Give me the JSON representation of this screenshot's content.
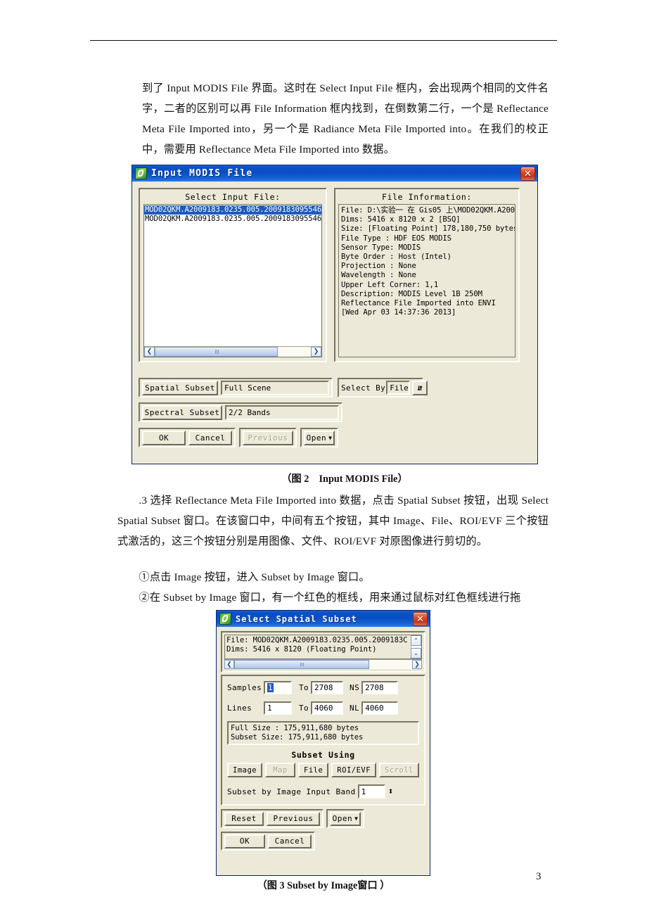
{
  "document": {
    "page_number": "3",
    "paragraph_top": "到了 Input MODIS File 界面。这时在 Select Input File 框内，会出现两个相同的文件名字，二者的区别可以再 File Information 框内找到，在倒数第二行，一个是 Reflectance Meta File Imported into，另一个是 Radiance Meta File Imported into。在我们的校正中，需要用 Reflectance Meta File Imported into 数据。",
    "figure2_caption": "（图 2　Input MODIS File）",
    "paragraph_mid": ".3 选择 Reflectance Meta File Imported into 数据，点击 Spatial Subset 按钮，出现 Select Spatial Subset 窗口。在该窗口中，中间有五个按钮，其中 Image、File、ROI/EVF 三个按钮式激活的，这三个按钮分别是用图像、文件、ROI/EVF 对原图像进行剪切的。",
    "paragraph_item1": "①点击 Image 按钮，进入 Subset by Image 窗口。",
    "paragraph_item2": "②在 Subset by Image 窗口，有一个红色的框线，用来通过鼠标对红色框线进行拖",
    "figure3_caption": "（图 3  Subset by Image窗口 ）"
  },
  "colors": {
    "titlebar_blue": "#0a4ec4",
    "dialog_face": "#ece9d8",
    "selection_blue": "#1f5bbf",
    "close_red": "#c5351a"
  },
  "input_modis_dialog": {
    "title": "Input MODIS File",
    "close_label": "✕",
    "select_input_file": {
      "group_label": "Select Input File:",
      "items": [
        "MOD02QKM.A2009183.0235.005.2009183095546",
        "MOD02QKM.A2009183.0235.005.2009183095546"
      ],
      "selected_index": 0,
      "scroll_left_arrow": "❮",
      "scroll_right_arrow": "❯"
    },
    "file_information": {
      "group_label": "File Information:",
      "lines": [
        "File: D:\\实验一 在 Gis05 上\\MOD02QKM.A200",
        "Dims: 5416 x 8120 x 2 [BSQ]",
        "Size: [Floating Point] 178,180,750 bytes.",
        "File Type  : HDF EOS MODIS",
        "Sensor Type: MODIS",
        "Byte Order : Host (Intel)",
        "Projection : None",
        "Wavelength : None",
        "Upper Left Corner: 1,1",
        "Description: MODIS Level 1B 250M",
        "Reflectance File Imported into ENVI",
        "[Wed Apr 03 14:37:36 2013]"
      ]
    },
    "spatial_subset": {
      "button_label": "Spatial Subset",
      "value": "Full Scene"
    },
    "spectral_subset": {
      "button_label": "Spectral Subset",
      "value": "2/2 Bands"
    },
    "select_by": {
      "label": "Select By",
      "value": "File",
      "toggle_icon": "⇵"
    },
    "buttons": {
      "ok": "OK",
      "cancel": "Cancel",
      "previous": "Previous",
      "previous_disabled": true,
      "open": "Open",
      "open_arrow": "▼"
    }
  },
  "spatial_subset_dialog": {
    "title": "Select Spatial Subset",
    "close_label": "✕",
    "file_info": {
      "lines": [
        "File: MOD02QKM.A2009183.0235.005.2009183C",
        "Dims: 5416 x 8120 (Floating Point)"
      ],
      "up_arrow": "⌃",
      "down_arrow": "⌄",
      "scroll_left_arrow": "❮",
      "scroll_right_arrow": "❯"
    },
    "samples": {
      "label": "Samples",
      "from": "1",
      "to_label": "To",
      "to": "2708",
      "count_label": "NS",
      "count": "2708"
    },
    "lines": {
      "label": "Lines",
      "from": "1",
      "to_label": "To",
      "to": "4060",
      "count_label": "NL",
      "count": "4060"
    },
    "sizes": {
      "full": "Full Size  : 175,911,680 bytes",
      "subset": "Subset Size: 175,911,680 bytes"
    },
    "subset_using": {
      "heading": "Subset Using",
      "buttons": [
        {
          "label": "Image",
          "disabled": false
        },
        {
          "label": "Map",
          "disabled": true
        },
        {
          "label": "File",
          "disabled": false
        },
        {
          "label": "ROI/EVF",
          "disabled": false
        },
        {
          "label": "Scroll",
          "disabled": true
        }
      ]
    },
    "input_band": {
      "label": "Subset by Image Input Band",
      "value": "1",
      "spinner_icon": "⬍"
    },
    "buttons": {
      "reset": "Reset",
      "previous": "Previous",
      "open": "Open",
      "open_arrow": "▼",
      "ok": "OK",
      "cancel": "Cancel"
    }
  }
}
